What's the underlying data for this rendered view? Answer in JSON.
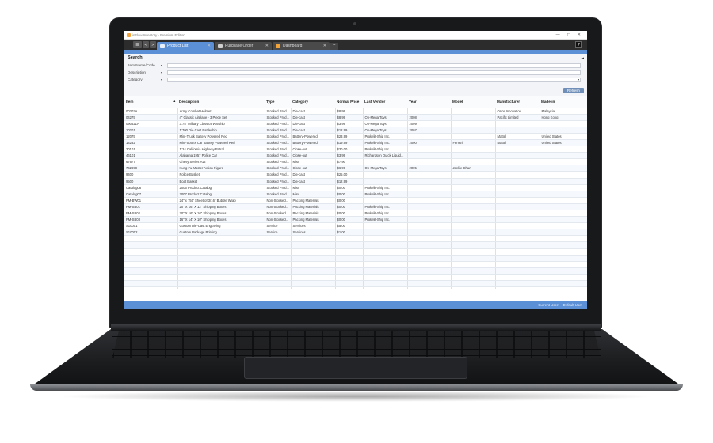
{
  "window": {
    "title": "inFlow Inventory - Premium Edition",
    "controls": [
      "—",
      "◻",
      "✕"
    ]
  },
  "tabs": [
    {
      "label": "Product List",
      "icon": "list-icon",
      "active": true
    },
    {
      "label": "Purchase Order",
      "icon": "purchase-order-icon",
      "active": false
    },
    {
      "label": "Dashboard",
      "icon": "dashboard-icon",
      "active": false
    }
  ],
  "toolbar": {
    "menu": "☰",
    "back": "<",
    "forward": ">",
    "add_tab": "+",
    "help": "?"
  },
  "search": {
    "title": "Search",
    "collapse": "◂",
    "fields": [
      {
        "label": "Item Name/Code",
        "caret": "▾"
      },
      {
        "label": "Description",
        "caret": "▾"
      },
      {
        "label": "Category",
        "caret": "▾",
        "dropdown": "▾"
      }
    ],
    "refresh_label": "Refresh"
  },
  "grid": {
    "columns": [
      "Item",
      "Description",
      "Type",
      "Category",
      "Normal Price",
      "Last Vendor",
      "Year",
      "Model",
      "Manufacturer",
      "Made-in"
    ],
    "sort_indicator": "▲",
    "rows": [
      [
        "00303A",
        "Army Combat Helmet",
        "Stocked Prod...",
        "Die-cast",
        "$8.99",
        "",
        "",
        "",
        "Once Innovation",
        "Malaysia"
      ],
      [
        "04275",
        "4\" Classic Airplane - 3 Piece Set",
        "Stocked Prod...",
        "Die-cast",
        "$8.99",
        "Oh-Mega Toys",
        "2008",
        "",
        "Pacific Limited",
        "Hong Kong"
      ],
      [
        "090521A",
        "3.75\" Military Classics Warship",
        "Stocked Prod...",
        "Die-cast",
        "$3.99",
        "Oh-Mega Toys",
        "2009",
        "",
        "",
        ""
      ],
      [
        "10201",
        "1:700 Die Cast Battleship",
        "Stocked Prod...",
        "Die-cast",
        "$12.99",
        "Oh-Mega Toys",
        "2007",
        "",
        "",
        ""
      ],
      [
        "12075",
        "Mini-Truck Battery Powered Red",
        "Stocked Prod...",
        "Battery-Powered",
        "$23.99",
        "Prokelit-Ship Inc.",
        "",
        "",
        "Mattel",
        "United States"
      ],
      [
        "14232",
        "Mini-Sports Car Battery Powered Red",
        "Stocked Prod...",
        "Battery-Powered",
        "$19.99",
        "Prokelit-Ship Inc.",
        "2000",
        "Ferrari",
        "Mattel",
        "United States"
      ],
      [
        "20101",
        "1:24 California Highway Patrol",
        "Stocked Prod...",
        "Close-out",
        "$30.00",
        "Prokelit-Ship Inc.",
        "",
        "",
        "",
        ""
      ],
      [
        "46101",
        "Alabama 1957 Police Car",
        "Stocked Prod...",
        "Close-out",
        "$3.99",
        "Richardson Quick Liquid...",
        "",
        "",
        "",
        ""
      ],
      [
        "67677",
        "Chevy Series #12",
        "Stocked Prod...",
        "Misc",
        "$7.90",
        "",
        "",
        "",
        "",
        ""
      ],
      [
        "762698",
        "Kung Fu Master Action Figure",
        "Stocked Prod...",
        "Close-out",
        "$6.99",
        "Oh-Mega Toys",
        "2005",
        "Jackie Chan",
        "",
        ""
      ],
      [
        "9400",
        "Police Basket",
        "Stocked Prod...",
        "Die-cast",
        "$25.00",
        "",
        "",
        "",
        "",
        ""
      ],
      [
        "9500",
        "Boat Basket",
        "Stocked Prod...",
        "Die-cast",
        "$12.99",
        "",
        "",
        "",
        "",
        ""
      ],
      [
        "Catalog06",
        "2006 Product Catalog",
        "Stocked Prod...",
        "Misc",
        "$0.00",
        "Prokelit-Ship Inc.",
        "",
        "",
        "",
        ""
      ],
      [
        "Catalog07",
        "2007 Product Catalog",
        "Stocked Prod...",
        "Misc",
        "$0.00",
        "Prokelit-Ship Inc.",
        "",
        "",
        "",
        ""
      ],
      [
        "PM-BW01",
        "24\" x 750' Sheet of 3/16\" Bubble Wrap",
        "Non-Stocked...",
        "Packing Materials",
        "$0.00",
        "",
        "",
        "",
        "",
        ""
      ],
      [
        "PM-SB01",
        "20\" X 16\" X 12\" Shipping Boxes",
        "Non-Stocked...",
        "Packing Materials",
        "$0.00",
        "Prokelit-Ship Inc.",
        "",
        "",
        "",
        ""
      ],
      [
        "PM-SB02",
        "20\" X 16\" X 16\" Shipping Boxes",
        "Non-Stocked...",
        "Packing Materials",
        "$0.00",
        "Prokelit-Ship Inc.",
        "",
        "",
        "",
        ""
      ],
      [
        "PM-SB03",
        "16\" X 14\" X 10\" Shipping Boxes",
        "Non-Stocked...",
        "Packing Materials",
        "$0.00",
        "Prokelit-Ship Inc.",
        "",
        "",
        "",
        ""
      ],
      [
        "S10001",
        "Custom Die-Cast Engraving",
        "Service",
        "Services",
        "$5.00",
        "",
        "",
        "",
        "",
        ""
      ],
      [
        "S10002",
        "Custom Package Printing",
        "Service",
        "Services",
        "$1.00",
        "",
        "",
        "",
        "",
        ""
      ]
    ],
    "empty_rows": 10
  },
  "status": {
    "current_user_label": "Current User:",
    "user": "Default User"
  },
  "colors": {
    "accent": "#5b8fd6",
    "tabbar": "#2c2c2c",
    "refresh": "#6f8fb8"
  }
}
